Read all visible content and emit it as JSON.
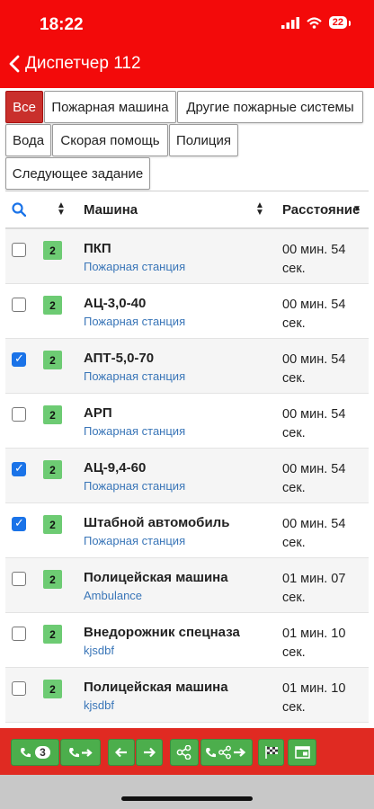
{
  "status": {
    "time": "18:22",
    "battery": "22"
  },
  "nav": {
    "title": "Диспетчер 112"
  },
  "filters": [
    "Все",
    "Пожарная машина",
    "Другие пожарные системы",
    "Вода",
    "Скорая помощь",
    "Полиция",
    "Следующее задание"
  ],
  "table": {
    "headers": {
      "vehicle": "Машина",
      "distance": "Расстояние"
    },
    "rows": [
      {
        "count": "2",
        "name": "ПКП",
        "station": "Пожарная станция",
        "dist1": "00 мин. 54",
        "dist2": "сек.",
        "checked": false
      },
      {
        "count": "2",
        "name": "АЦ-3,0-40",
        "station": "Пожарная станция",
        "dist1": "00 мин. 54",
        "dist2": "сек.",
        "checked": false
      },
      {
        "count": "2",
        "name": "АПТ-5,0-70",
        "station": "Пожарная станция",
        "dist1": "00 мин. 54",
        "dist2": "сек.",
        "checked": true
      },
      {
        "count": "2",
        "name": "АРП",
        "station": "Пожарная станция",
        "dist1": "00 мин. 54",
        "dist2": "сек.",
        "checked": false
      },
      {
        "count": "2",
        "name": "АЦ-9,4-60",
        "station": "Пожарная станция",
        "dist1": "00 мин. 54",
        "dist2": "сек.",
        "checked": true
      },
      {
        "count": "2",
        "name": "Штабной автомобиль",
        "station": "Пожарная станция",
        "dist1": "00 мин. 54",
        "dist2": "сек.",
        "checked": true
      },
      {
        "count": "2",
        "name": "Полицейская машина",
        "station": "Ambulance",
        "dist1": "01 мин. 07",
        "dist2": "сек.",
        "checked": false
      },
      {
        "count": "2",
        "name": "Внедорожник спецназа",
        "station": "kjsdbf",
        "dist1": "01 мин. 10",
        "dist2": "сек.",
        "checked": false
      },
      {
        "count": "2",
        "name": "Полицейская машина",
        "station": "kjsdbf",
        "dist1": "01 мин. 10",
        "dist2": "сек.",
        "checked": false
      }
    ]
  },
  "toolbar": {
    "call_count": "3"
  },
  "colors": {
    "header": "#f30a0a",
    "active_filter": "#c9302c",
    "badge": "#6dcb73",
    "toolbar_button": "#4cae4c",
    "checkbox_checked": "#1a73e8"
  }
}
